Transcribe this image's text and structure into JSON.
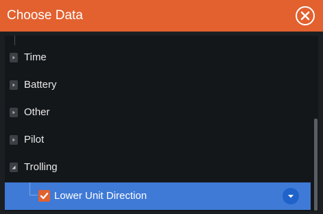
{
  "dialog": {
    "title": "Choose Data",
    "close_icon": "close-circle-icon"
  },
  "list": {
    "items": [
      {
        "label": "Time",
        "state": "collapsed"
      },
      {
        "label": "Battery",
        "state": "collapsed"
      },
      {
        "label": "Other",
        "state": "collapsed"
      },
      {
        "label": "Pilot",
        "state": "collapsed"
      },
      {
        "label": "Trolling",
        "state": "expanded"
      }
    ],
    "selected_child": {
      "label": "Lower Unit Direction",
      "checked": true,
      "dropdown_icon": "chevron-down-icon"
    }
  },
  "colors": {
    "title_bar": "#e2612f",
    "selection": "#3f7ad6",
    "checkbox": "#e2612f",
    "dropdown": "#1f62c9"
  }
}
